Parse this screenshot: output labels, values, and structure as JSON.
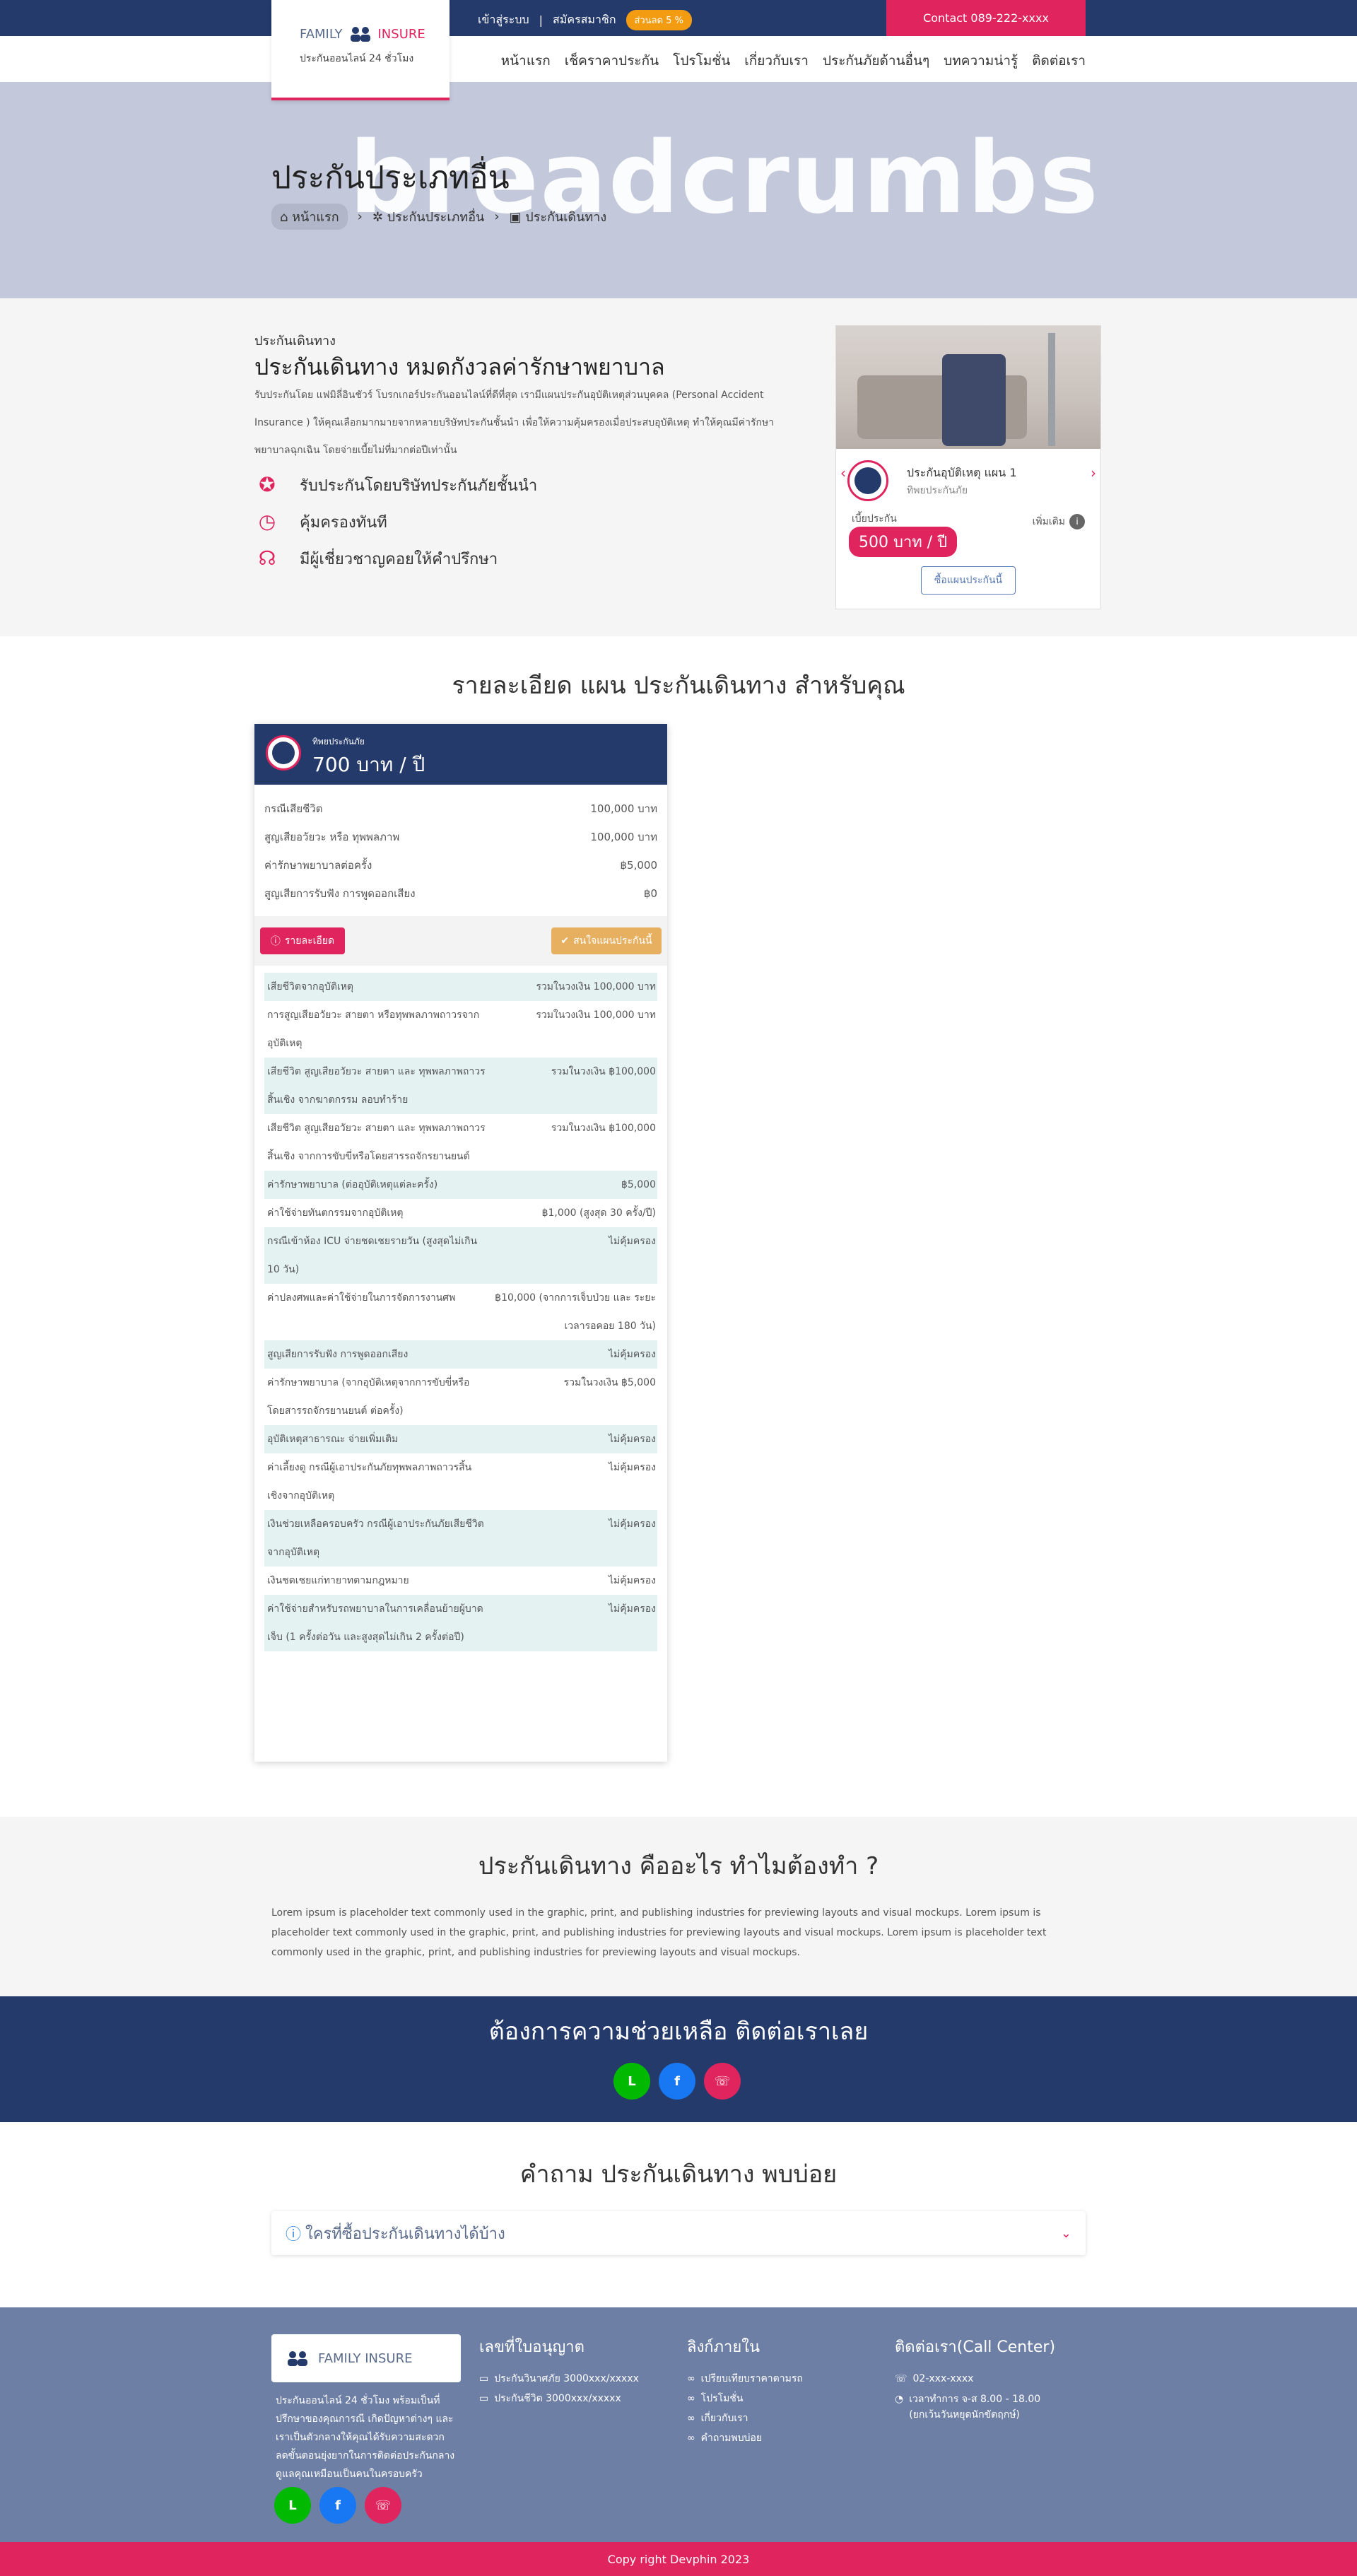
{
  "topbar": {
    "login": "เข้าสู่ระบบ",
    "separator": "|",
    "register": "สมัครสมาชิก",
    "promo": "ส่วนลด 5 %",
    "contact": "Contact 089-222-xxxx"
  },
  "brand": {
    "family": "FAMILY",
    "insure": "INSURE",
    "tagline": "ประกันออนไลน์ 24 ชั่วโมง"
  },
  "nav": [
    "หน้าแรก",
    "เช็คราคาประกัน",
    "โปรโมชั่น",
    "เกี่ยวกับเรา",
    "ประกันภัยด้านอื่นๆ",
    "บทความน่ารู้",
    "ติดต่อเรา"
  ],
  "hero": {
    "bg_word": "breadcrumbs",
    "title": "ประกันประเภทอื่น",
    "crumbs": [
      "หน้าแรก",
      "ประกันประเภทอื่น",
      "ประกันเดินทาง"
    ]
  },
  "intro": {
    "small": "ประกันเดินทาง",
    "headline": "ประกันเดินทาง หมดกังวลค่ารักษาพยาบาล",
    "desc": "รับประกันโดย แฟมิลี่อินชัวร์ โบรกเกอร์ประกันออนไลน์ที่ดีที่สุด เรามีแผนประกันอุบัติเหตุส่วนบุคคล (Personal Accident Insurance ) ให้คุณเลือกมากมายจากหลายบริษัทประกันชั้นนำ เพื่อให้ความคุ้มครองเมื่อประสบอุบัติเหตุ ทำให้คุณมีค่ารักษาพยาบาลฉุกเฉิน โดยจ่ายเบี้ยไม่ที่มากต่อปีเท่านั้น",
    "features": [
      "รับประกันโดยบริษัทประกันภัยชั้นนำ",
      "คุ้มครองทันที",
      "มีผู้เชี่ยวชาญคอยให้คำปรึกษา"
    ]
  },
  "plan_card": {
    "name": "ประกันอุบัติเหตุ แผน 1",
    "company": "ทิพยประกันภัย",
    "premium_label": "เบี้ยประกัน",
    "price": "500 บาท / ปี",
    "more": "เพิ่มเติม",
    "buy": "ซื้อแผนประกันนี้"
  },
  "detail": {
    "title": "รายละเอียด แผน ประกันเดินทาง สำหรับคุณ",
    "company": "ทิพยประกันภัย",
    "price": "700 บาท / ปี",
    "summary": [
      {
        "label": "กรณีเสียชีวิต",
        "value": "100,000 บาท"
      },
      {
        "label": "สูญเสียอวัยวะ หรือ ทุพพลภาพ",
        "value": "100,000 บาท"
      },
      {
        "label": "ค่ารักษาพยาบาลต่อครั้ง",
        "value": "฿5,000"
      },
      {
        "label": "สูญเสียการรับฟัง การพูดออกเสียง",
        "value": "฿0"
      }
    ],
    "btn_detail": "รายละเอียด",
    "btn_buy": "สนใจแผนประกันนี้",
    "coverage": [
      {
        "label": "เสียชีวิตจากอุบัติเหตุ",
        "value": "รวมในวงเงิน 100,000 บาท",
        "alt": true
      },
      {
        "label": "การสูญเสียอวัยวะ สายตา หรือทุพพลภาพถาวรจากอุบัติเหตุ",
        "value": "รวมในวงเงิน 100,000 บาท",
        "alt": false
      },
      {
        "label": "เสียชีวิต สูญเสียอวัยวะ สายตา และ ทุพพลภาพถาวรสิ้นเชิง จากฆาตกรรม ลอบทำร้าย",
        "value": "รวมในวงเงิน ฿100,000",
        "alt": true
      },
      {
        "label": "เสียชีวิต สูญเสียอวัยวะ สายตา และ ทุพพลภาพถาวรสิ้นเชิง จากการขับขี่หรือโดยสารรถจักรยานยนต์",
        "value": "รวมในวงเงิน ฿100,000",
        "alt": false
      },
      {
        "label": "ค่ารักษาพยาบาล (ต่ออุบัติเหตุแต่ละครั้ง)",
        "value": "฿5,000",
        "alt": true
      },
      {
        "label": "ค่าใช้จ่ายทันตกรรมจากอุบัติเหตุ",
        "value": "฿1,000 (สูงสุด 30 ครั้ง/ปี)",
        "alt": false
      },
      {
        "label": "กรณีเข้าห้อง ICU จ่ายชดเชยรายวัน (สูงสุดไม่เกิน 10 วัน)",
        "value": "ไม่คุ้มครอง",
        "alt": true
      },
      {
        "label": "ค่าปลงศพและค่าใช้จ่ายในการจัดการงานศพ",
        "value": "฿10,000 (จากการเจ็บป่วย และ ระยะเวลารอคอย 180 วัน)",
        "alt": false
      },
      {
        "label": "สูญเสียการรับฟัง การพูดออกเสียง",
        "value": "ไม่คุ้มครอง",
        "alt": true
      },
      {
        "label": "ค่ารักษาพยาบาล (จากอุบัติเหตุจากการขับขี่หรือโดยสารรถจักรยานยนต์ ต่อครั้ง)",
        "value": "รวมในวงเงิน ฿5,000",
        "alt": false
      },
      {
        "label": "อุบัติเหตุสาธารณะ จ่ายเพิ่มเติม",
        "value": "ไม่คุ้มครอง",
        "alt": true
      },
      {
        "label": "ค่าเลี้ยงดู กรณีผู้เอาประกันภัยทุพพลภาพถาวรสิ้นเชิงจากอุบัติเหตุ",
        "value": "ไม่คุ้มครอง",
        "alt": false
      },
      {
        "label": "เงินช่วยเหลือครอบครัว กรณีผู้เอาประกันภัยเสียชีวิตจากอุบัติเหตุ",
        "value": "ไม่คุ้มครอง",
        "alt": true
      },
      {
        "label": "เงินชดเชยแก่ทายาทตามกฎหมาย",
        "value": "ไม่คุ้มครอง",
        "alt": false
      },
      {
        "label": "ค่าใช้จ่ายสำหรับรถพยาบาลในการเคลื่อนย้ายผู้บาดเจ็บ (1 ครั้งต่อวัน และสูงสุดไม่เกิน 2 ครั้งต่อปี)",
        "value": "ไม่คุ้มครอง",
        "alt": true
      }
    ]
  },
  "whatis": {
    "title": "ประกันเดินทาง คืออะไร ทำไมต้องทำ ?",
    "text": "Lorem ipsum is placeholder text commonly used in the graphic, print, and publishing industries for previewing layouts and visual mockups. Lorem ipsum is placeholder text commonly used in the graphic, print, and publishing industries for previewing layouts and visual mockups. Lorem ipsum is placeholder text commonly used in the graphic, print, and publishing industries for previewing layouts and visual mockups."
  },
  "help": {
    "title": "ต้องการความช่วยเหลือ ติดต่อเราเลย"
  },
  "faq": {
    "title": "คำถาม ประกันเดินทาง พบบ่อย",
    "items": [
      "ใครที่ซื้อประกันเดินทางได้บ้าง"
    ]
  },
  "footer": {
    "logo_text": "FAMILY INSURE",
    "about": "ประกันออนไลน์ 24 ชั่วโมง พร้อมเป็นที่ปรึกษาของคุณการณี เกิดปัญหาต่างๆ และเราเป็นตัวกลางให้คุณได้รับความสะดวก ลดขั้นตอนยุ่งยากในการติดต่อประกันกลาง ดูแลคุณเหมือนเป็นคนในครอบครัว",
    "license_title": "เลขที่ใบอนุญาต",
    "licenses": [
      "ประกันวินาศภัย 3000xxx/xxxxx",
      "ประกันชีวิต 3000xxx/xxxxx"
    ],
    "links_title": "ลิงก์ภายใน",
    "links": [
      "เปรียบเทียบราคาตามรถ",
      "โปรโมชั่น",
      "เกี่ยวกับเรา",
      "คำถามพบบ่อย"
    ],
    "contact_title": "ติดต่อเรา(Call Center)",
    "phone": "02-xxx-xxxx",
    "hours": "เวลาทำการ จ-ส 8.00 - 18.00",
    "hours_note": "(ยกเว้นวันหยุดนักขัตฤกษ์)"
  },
  "copyright": "Copy right Devphin 2023",
  "colors": {
    "navy": "#243a6b",
    "pink": "#e0245e",
    "hero_bg": "#c3c8da",
    "footer_bg": "#6e7fa5"
  }
}
